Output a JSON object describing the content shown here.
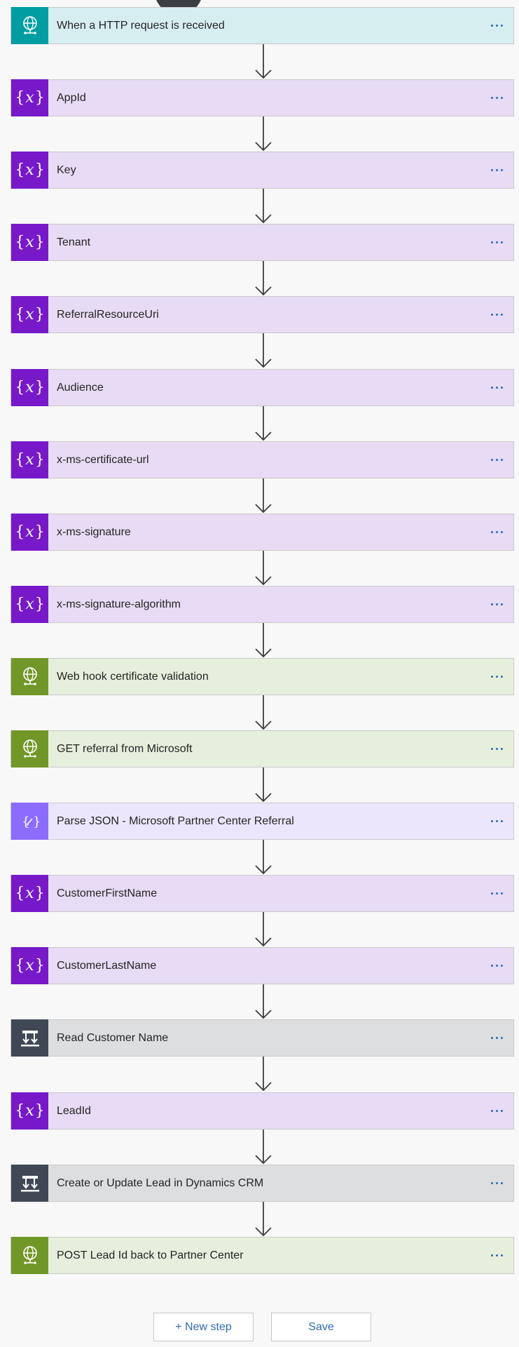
{
  "steps": [
    {
      "label": "When a HTTP request is received",
      "type": "http-trigger",
      "icon": "http-globe-icon",
      "bg": "#d7eef1",
      "icon_bg": "#009ea3"
    },
    {
      "label": "AppId",
      "type": "variable",
      "icon": "variable-icon",
      "bg": "#e7dbf5",
      "icon_bg": "#7719c9"
    },
    {
      "label": "Key",
      "type": "variable",
      "icon": "variable-icon",
      "bg": "#e7dbf5",
      "icon_bg": "#7719c9"
    },
    {
      "label": "Tenant",
      "type": "variable",
      "icon": "variable-icon",
      "bg": "#e7dbf5",
      "icon_bg": "#7719c9"
    },
    {
      "label": "ReferralResourceUri",
      "type": "variable",
      "icon": "variable-icon",
      "bg": "#e7dbf5",
      "icon_bg": "#7719c9"
    },
    {
      "label": "Audience",
      "type": "variable",
      "icon": "variable-icon",
      "bg": "#e7dbf5",
      "icon_bg": "#7719c9"
    },
    {
      "label": "x-ms-certificate-url",
      "type": "variable",
      "icon": "variable-icon",
      "bg": "#e7dbf5",
      "icon_bg": "#7719c9"
    },
    {
      "label": "x-ms-signature",
      "type": "variable",
      "icon": "variable-icon",
      "bg": "#e7dbf5",
      "icon_bg": "#7719c9"
    },
    {
      "label": "x-ms-signature-algorithm",
      "type": "variable",
      "icon": "variable-icon",
      "bg": "#e7dbf5",
      "icon_bg": "#7719c9"
    },
    {
      "label": "Web hook certificate validation",
      "type": "http",
      "icon": "http-globe-icon",
      "bg": "#e6efdc",
      "icon_bg": "#709727"
    },
    {
      "label": "GET referral from Microsoft",
      "type": "http",
      "icon": "http-globe-icon",
      "bg": "#e6efdc",
      "icon_bg": "#709727"
    },
    {
      "label": "Parse JSON - Microsoft Partner Center Referral",
      "type": "parse-json",
      "icon": "parse-json-icon",
      "bg": "#ebe6fb",
      "icon_bg": "#8c6cff"
    },
    {
      "label": "CustomerFirstName",
      "type": "variable",
      "icon": "variable-icon",
      "bg": "#e7dbf5",
      "icon_bg": "#7719c9"
    },
    {
      "label": "CustomerLastName",
      "type": "variable",
      "icon": "variable-icon",
      "bg": "#e7dbf5",
      "icon_bg": "#7719c9"
    },
    {
      "label": "Read Customer Name",
      "type": "scope",
      "icon": "scope-icon",
      "bg": "#dcdee0",
      "icon_bg": "#404856"
    },
    {
      "label": "LeadId",
      "type": "variable",
      "icon": "variable-icon",
      "bg": "#e7dbf5",
      "icon_bg": "#7719c9"
    },
    {
      "label": "Create or Update Lead in Dynamics CRM",
      "type": "scope",
      "icon": "scope-icon",
      "bg": "#dcdee0",
      "icon_bg": "#404856"
    },
    {
      "label": "POST Lead Id back to Partner Center",
      "type": "http",
      "icon": "http-globe-icon",
      "bg": "#e6efdc",
      "icon_bg": "#709727"
    }
  ],
  "footer": {
    "new_step_label": "+ New step",
    "save_label": "Save"
  }
}
